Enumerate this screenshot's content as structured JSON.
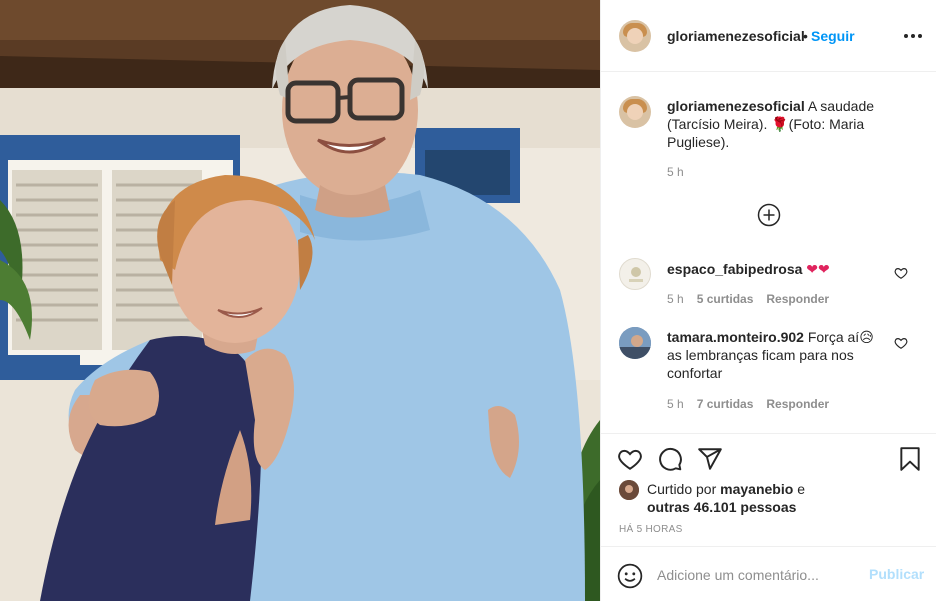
{
  "post": {
    "photo_alt": "",
    "header": {
      "username": "gloriamenezesoficial",
      "dot": "•",
      "follow_label": "Seguir",
      "more_icon": "more-horizontal-icon"
    },
    "caption": {
      "username": "gloriamenezesoficial",
      "text": "A saudade (Tarcísio Meira). 🌹(Foto: Maria Pugliese).",
      "time": "5 h"
    },
    "load_more_icon": "plus-circle-icon",
    "comments": [
      {
        "username": "espaco_fabipedrosa",
        "text": "❤❤",
        "time": "5 h",
        "likes": "5 curtidas",
        "reply": "Responder"
      },
      {
        "username": "tamara.monteiro.902",
        "text": "Força aí😥 as lembranças ficam para nos confortar",
        "time": "5 h",
        "likes": "7 curtidas",
        "reply": "Responder"
      }
    ],
    "actions": {
      "like_icon": "heart-icon",
      "comment_icon": "comment-icon",
      "share_icon": "paper-plane-icon",
      "save_icon": "bookmark-icon"
    },
    "liked_by": {
      "prefix": "Curtido por",
      "user": "mayanebio",
      "conj": "e",
      "others": "outras 46.101 pessoas"
    },
    "timestamp": "HÁ 5 HORAS",
    "add_comment": {
      "placeholder": "Adicione um comentário...",
      "publish_label": "Publicar",
      "emoji_icon": "smiley-icon"
    },
    "colors": {
      "link_blue": "#0095f6",
      "publish_disabled": "#b2dffc",
      "heart_red": "#ed4956",
      "muted": "#8e8e8e"
    }
  }
}
